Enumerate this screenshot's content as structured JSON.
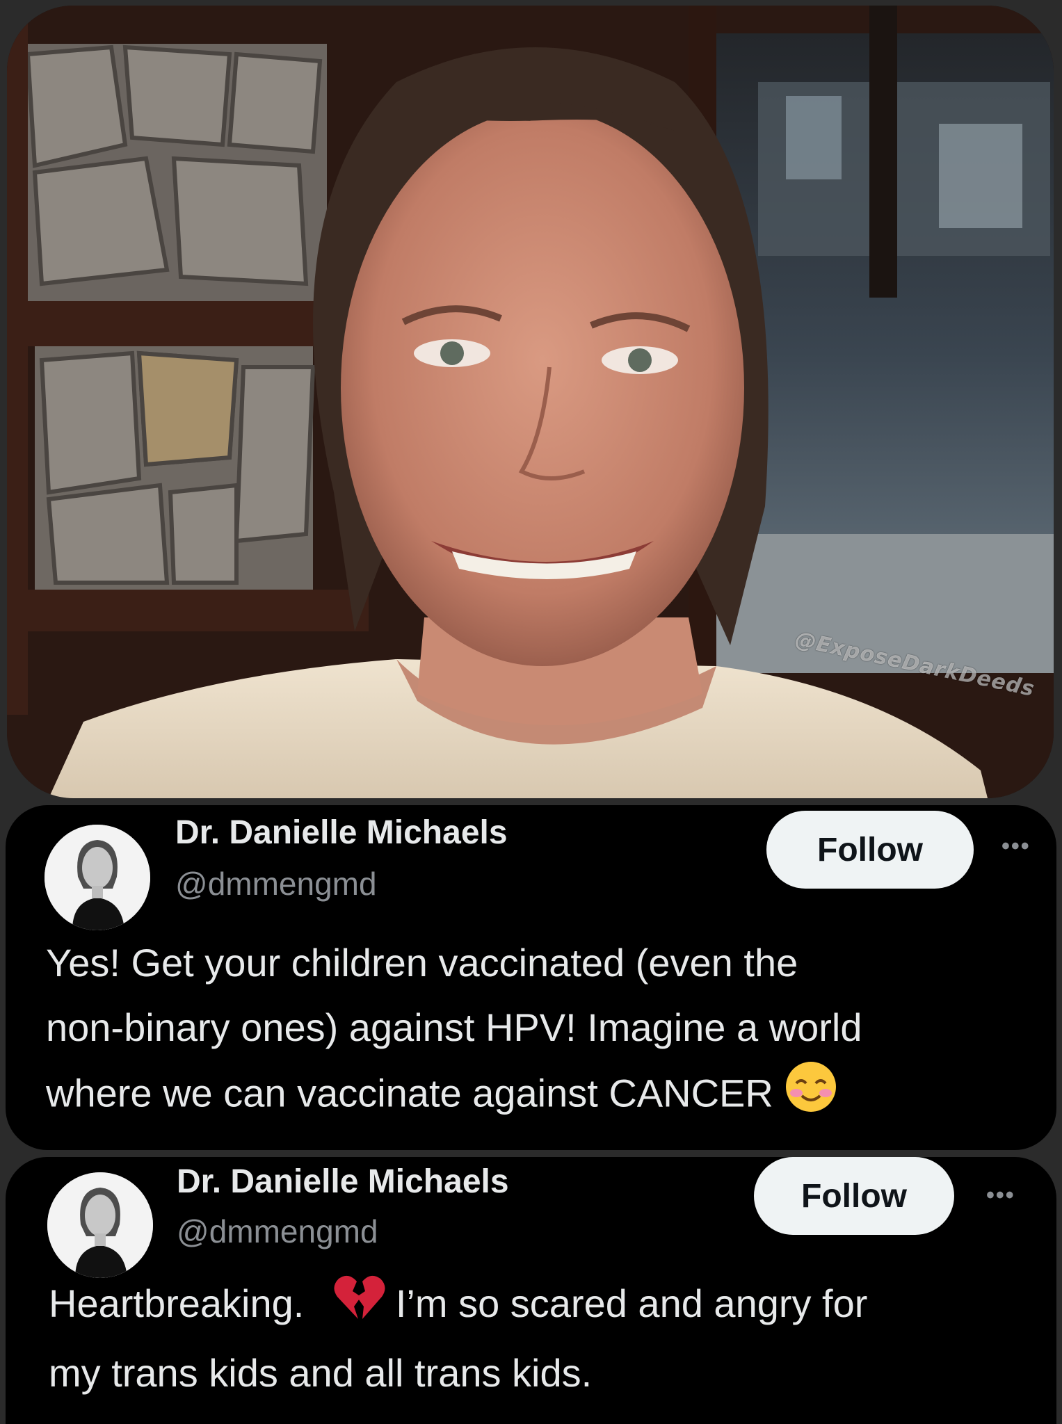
{
  "photo": {
    "watermark": "@ExposeDarkDeeds"
  },
  "tweets": [
    {
      "name": "Dr. Danielle Michaels",
      "handle": "@dmmengmd",
      "follow_label": "Follow",
      "more_label": "•••",
      "lines": [
        "Yes! Get your children vaccinated (even the",
        "non-binary ones) against HPV! Imagine a world",
        "where we can vaccinate against CANCER"
      ],
      "emoji": "smiling-face-with-smiling-eyes-icon"
    },
    {
      "name": "Dr. Danielle Michaels",
      "handle": "@dmmengmd",
      "follow_label": "Follow",
      "more_label": "•••",
      "lines": [
        "Heartbreaking.",
        "I’m so scared and angry for",
        "my trans kids and all trans kids."
      ],
      "emoji": "broken-heart-icon"
    }
  ],
  "colors": {
    "background": "#2b2b2b",
    "card": "#000000",
    "text": "#e7e9ea",
    "muted": "#8b8f94",
    "follow_bg": "#eff3f4"
  }
}
